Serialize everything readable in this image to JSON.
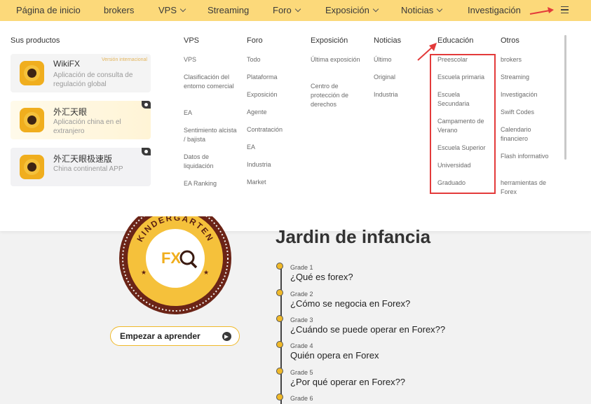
{
  "nav": {
    "items": [
      {
        "label": "Página de inicio",
        "dropdown": false
      },
      {
        "label": "brokers",
        "dropdown": false
      },
      {
        "label": "VPS",
        "dropdown": true
      },
      {
        "label": "Streaming",
        "dropdown": false
      },
      {
        "label": "Foro",
        "dropdown": true
      },
      {
        "label": "Exposición",
        "dropdown": true
      },
      {
        "label": "Noticias",
        "dropdown": true
      },
      {
        "label": "Investigación",
        "dropdown": false
      }
    ],
    "menu_icon": "hamburger-icon"
  },
  "products": {
    "heading": "Sus productos",
    "cards": [
      {
        "title": "WikiFX",
        "badge": "Versión internacional",
        "subtitle": "Aplicación de consulta de regulación global"
      },
      {
        "title": "外汇天眼",
        "badge": "",
        "subtitle": "Aplicación china en el extranjero"
      },
      {
        "title": "外汇天眼极速版",
        "badge": "",
        "subtitle": "China continental APP"
      }
    ]
  },
  "menu": {
    "columns": [
      {
        "heading": "VPS",
        "links": [
          "VPS",
          "Clasificación del entorno comercial",
          "EA",
          "Sentimiento alcista / bajista",
          "Datos de liquidación",
          "EA Ranking"
        ]
      },
      {
        "heading": "Foro",
        "links": [
          "Todo",
          "Plataforma",
          "Exposición",
          "Agente",
          "Contratación",
          "EA",
          "Industria",
          "Market"
        ]
      },
      {
        "heading": "Exposición",
        "links": [
          "Última exposición",
          "Centro de protección de derechos"
        ]
      },
      {
        "heading": "Noticias",
        "links": [
          "Último",
          "Original",
          "Industria"
        ]
      },
      {
        "heading": "Educación",
        "links": [
          "Preescolar",
          "Escuela primaria",
          "Escuela Secundaria",
          "Campamento de Verano",
          "Escuela Superior",
          "Universidad",
          "Graduado"
        ]
      },
      {
        "heading": "Otros",
        "links": [
          "brokers",
          "Streaming",
          "Investigación",
          "Swift Codes",
          "Calendario financiero",
          "Flash informativo",
          "herramientas de Forex"
        ]
      }
    ]
  },
  "badge": {
    "arc_text": "KINDERGARTEN",
    "center_text": "FX"
  },
  "learn_button": {
    "label": "Empezar a aprender"
  },
  "section": {
    "title": "Jardin de infancia",
    "lessons": [
      {
        "grade": "Grade 1",
        "title": "¿Qué es forex?"
      },
      {
        "grade": "Grade 2",
        "title": "¿Cómo se negocia en Forex?"
      },
      {
        "grade": "Grade 3",
        "title": "¿Cuándo se puede operar en Forex??"
      },
      {
        "grade": "Grade 4",
        "title": "Quién opera en Forex"
      },
      {
        "grade": "Grade 5",
        "title": "¿Por qué operar en Forex??"
      },
      {
        "grade": "Grade 6",
        "title": ""
      }
    ]
  },
  "colors": {
    "nav_bg": "#fcd97a",
    "accent": "#f0b929",
    "highlight": "#e33a3a",
    "brown": "#6b2417"
  }
}
